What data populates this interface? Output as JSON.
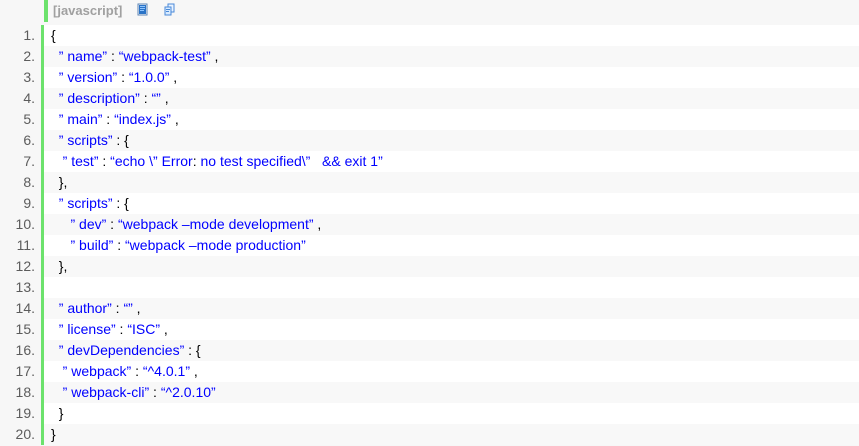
{
  "toolbar": {
    "language_label": "[javascript]",
    "icons": [
      "view-source-icon",
      "copy-code-icon"
    ],
    "accent_color": "#6ce26c",
    "label_color": "#a0a0a0"
  },
  "lines": [
    {
      "number": "1.",
      "text": "{"
    },
    {
      "number": "2.",
      "text": "  ” name” : “webpack-test” ,"
    },
    {
      "number": "3.",
      "text": "  ” version” : “1.0.0” ,"
    },
    {
      "number": "4.",
      "text": "  ” description” : “” ,"
    },
    {
      "number": "5.",
      "text": "  ” main” : “index.js” ,"
    },
    {
      "number": "6.",
      "text": "  ” scripts” : {"
    },
    {
      "number": "7.",
      "text": "   ” test” : “echo \\” Error: no test specified\\”   && exit 1”"
    },
    {
      "number": "8.",
      "text": "  },"
    },
    {
      "number": "9.",
      "text": "  ” scripts” : {"
    },
    {
      "number": "10.",
      "text": "     ” dev” : “webpack –mode development” ,"
    },
    {
      "number": "11.",
      "text": "     ” build” : “webpack –mode production”"
    },
    {
      "number": "12.",
      "text": "  },"
    },
    {
      "number": "13.",
      "text": ""
    },
    {
      "number": "14.",
      "text": "  ” author” : “” ,"
    },
    {
      "number": "15.",
      "text": "  ” license” : “ISC” ,"
    },
    {
      "number": "16.",
      "text": "  ” devDependencies” : {"
    },
    {
      "number": "17.",
      "text": "   ” webpack” : “^4.0.1” ,"
    },
    {
      "number": "18.",
      "text": "   ” webpack-cli” : “^2.0.10”"
    },
    {
      "number": "19.",
      "text": "  }"
    },
    {
      "number": "20.",
      "text": "}"
    }
  ],
  "colors": {
    "line_number": "#5c5c5c",
    "string": "#0000ff",
    "punctuation": "#000000",
    "stripe_even": "#f8f8f8",
    "stripe_odd": "#ffffff"
  }
}
